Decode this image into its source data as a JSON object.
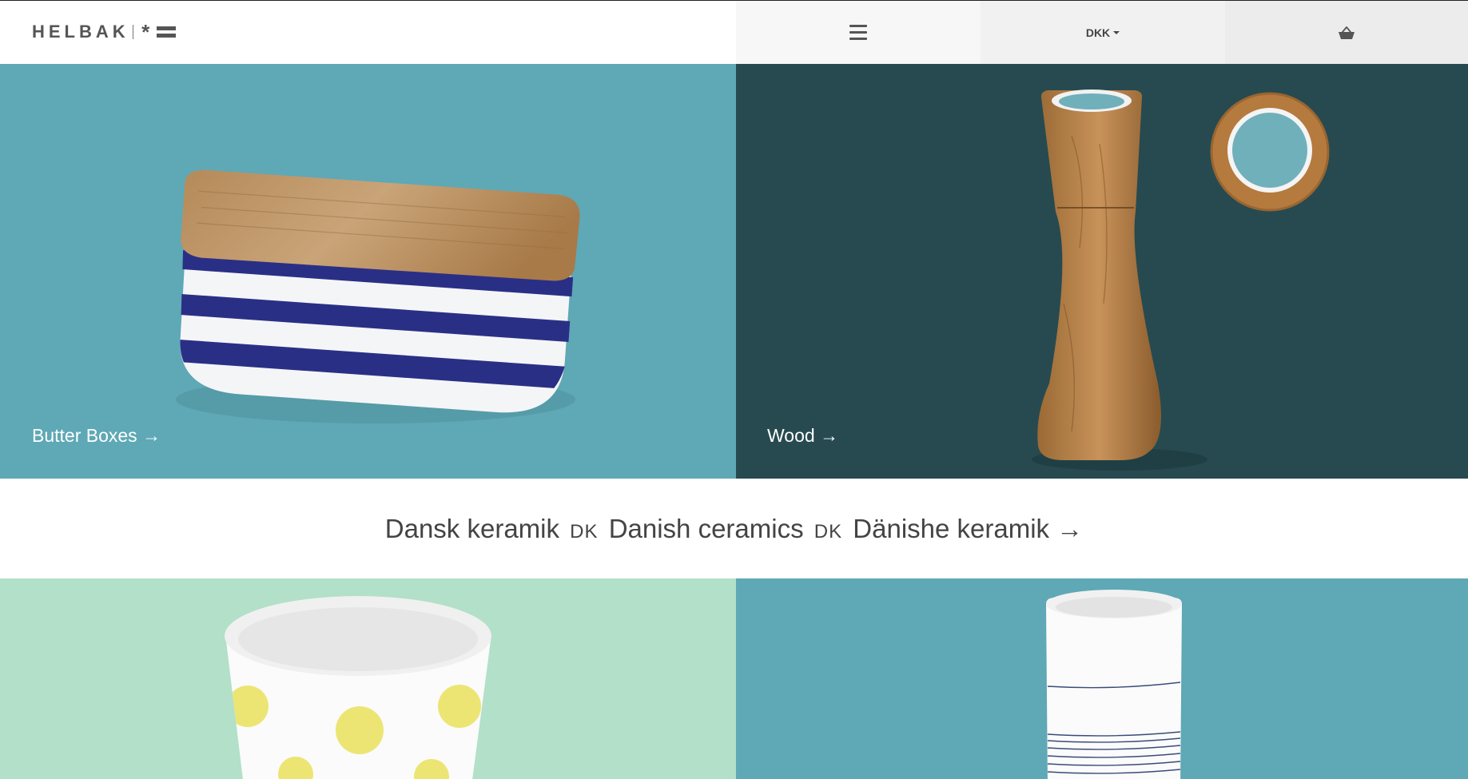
{
  "brand": {
    "name": "HELBAK",
    "star": "*"
  },
  "header": {
    "currency": "DKK",
    "menu_icon": "hamburger-menu-icon",
    "cart_icon": "basket-icon"
  },
  "panels": [
    {
      "label": "Butter Boxes",
      "arrow": "→",
      "color": "#5fa8b6"
    },
    {
      "label": "Wood",
      "arrow": "→",
      "color": "#264a50"
    }
  ],
  "band": {
    "part1": "Dansk keramik",
    "sep1": "DK",
    "part2": "Danish ceramics",
    "sep2": "DK",
    "part3": "Dänishe keramik",
    "arrow": "→"
  },
  "colors": {
    "teal": "#5fa8b6",
    "dark_teal": "#264a50",
    "mint": "#b2e0c8"
  }
}
